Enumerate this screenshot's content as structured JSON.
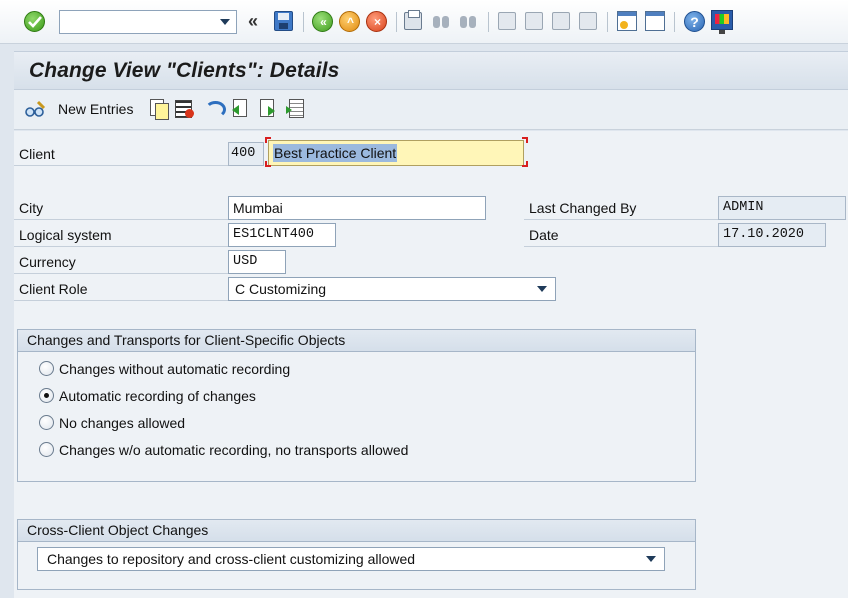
{
  "toolbar": {
    "command_field_value": "",
    "help_glyph": "?",
    "icons": [
      "enter-check-icon",
      "command-dropdown-icon",
      "double-chevron-icon",
      "save-icon",
      "back-icon",
      "exit-icon",
      "cancel-icon",
      "print-icon",
      "find-icon",
      "find-next-icon",
      "first-page-icon",
      "previous-page-icon",
      "next-page-icon",
      "last-page-icon",
      "new-session-icon",
      "create-shortcut-icon",
      "help-icon",
      "customize-layout-icon"
    ]
  },
  "title": "Change View \"Clients\": Details",
  "app_toolbar": {
    "new_entries_label": "New Entries",
    "icons": [
      "display-change-icon",
      "copy-as-icon",
      "delete-icon",
      "undo-change-icon",
      "previous-entry-icon",
      "next-entry-icon",
      "other-entry-icon"
    ]
  },
  "form": {
    "client_label": "Client",
    "client_value": "400",
    "client_name": "Best Practice Client",
    "city_label": "City",
    "city_value": "Mumbai",
    "logical_system_label": "Logical system",
    "logical_system_value": "ES1CLNT400",
    "currency_label": "Currency",
    "currency_value": "USD",
    "client_role_label": "Client Role",
    "client_role_value": "C Customizing",
    "last_changed_by_label": "Last Changed By",
    "last_changed_by_value": "ADMIN",
    "date_label": "Date",
    "date_value": "17.10.2020"
  },
  "changes_group": {
    "title": "Changes and Transports for Client-Specific Objects",
    "options": [
      {
        "label": "Changes without automatic recording",
        "selected": false
      },
      {
        "label": "Automatic recording of changes",
        "selected": true
      },
      {
        "label": "No changes allowed",
        "selected": false
      },
      {
        "label": "Changes w/o automatic recording, no transports allowed",
        "selected": false
      }
    ]
  },
  "cross_client_group": {
    "title": "Cross-Client Object Changes",
    "value": "Changes to repository and cross-client customizing allowed"
  },
  "colors": {
    "background": "#dfe6ee",
    "form_background": "#eef2f6",
    "highlight_field": "#fff6b8",
    "selection": "#9bb9de",
    "required_marker": "#d81f1f"
  }
}
